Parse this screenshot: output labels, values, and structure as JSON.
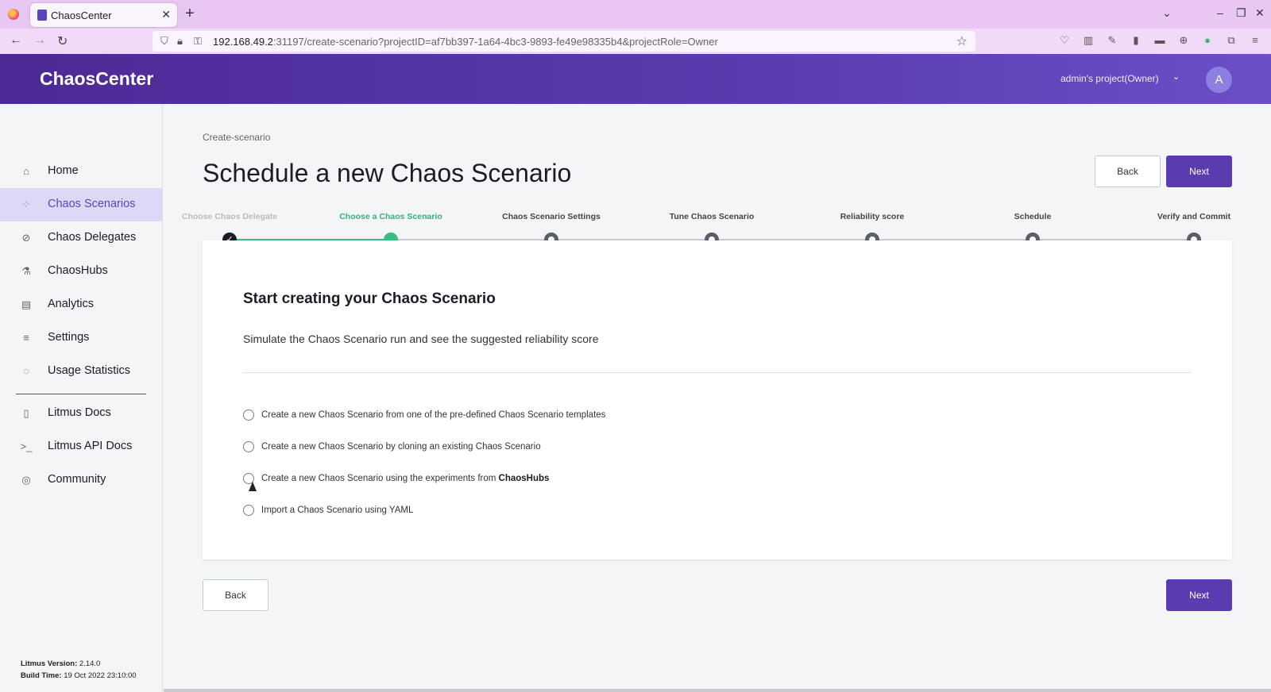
{
  "browser": {
    "tab_title": "ChaosCenter",
    "tab_close": "✕",
    "new_tab": "+",
    "tab_list": "⌄",
    "minimize": "–",
    "restore": "❐",
    "close": "✕",
    "url_host": "192.168.49.2",
    "url_rest": ":31197/create-scenario?projectID=af7bb397-1a64-4bc3-9893-fe49e98335b4&projectRole=Owner"
  },
  "header": {
    "brand": "ChaosCenter",
    "project": "admin's project(Owner)",
    "avatar_initial": "A"
  },
  "sidebar": {
    "items": [
      {
        "label": "Home",
        "icon": "⌂"
      },
      {
        "label": "Chaos Scenarios",
        "icon": "⁘"
      },
      {
        "label": "Chaos Delegates",
        "icon": "⊘"
      },
      {
        "label": "ChaosHubs",
        "icon": "⚗"
      },
      {
        "label": "Analytics",
        "icon": "▤"
      },
      {
        "label": "Settings",
        "icon": "≡"
      },
      {
        "label": "Usage Statistics",
        "icon": "◌"
      },
      {
        "label": "Litmus Docs",
        "icon": "▯"
      },
      {
        "label": "Litmus API Docs",
        "icon": ">_"
      },
      {
        "label": "Community",
        "icon": "◎"
      }
    ],
    "version_label": "Litmus Version:",
    "version_value": "2.14.0",
    "build_label": "Build Time:",
    "build_value": "19 Oct 2022 23:10:00"
  },
  "main": {
    "breadcrumb": "Create-scenario",
    "title": "Schedule a new Chaos Scenario",
    "back_label": "Back",
    "next_label": "Next",
    "steps": [
      {
        "label": "Choose Chaos Delegate",
        "state": "done"
      },
      {
        "label": "Choose a Chaos Scenario",
        "state": "current"
      },
      {
        "label": "Chaos Scenario Settings",
        "state": "todo"
      },
      {
        "label": "Tune Chaos Scenario",
        "state": "todo"
      },
      {
        "label": "Reliability score",
        "state": "todo"
      },
      {
        "label": "Schedule",
        "state": "todo"
      },
      {
        "label": "Verify and Commit",
        "state": "todo"
      }
    ],
    "card": {
      "title": "Start creating your Chaos Scenario",
      "subtitle": "Simulate the Chaos Scenario run and see the suggested reliability score",
      "options": [
        {
          "text": "Create a new Chaos Scenario from one of the pre-defined Chaos Scenario templates"
        },
        {
          "text": "Create a new Chaos Scenario by cloning an existing Chaos Scenario"
        },
        {
          "text": "Create a new Chaos Scenario using the experiments from ",
          "bold": "ChaosHubs"
        },
        {
          "text": "Import a Chaos Scenario using YAML"
        }
      ],
      "selected_option": null
    }
  }
}
